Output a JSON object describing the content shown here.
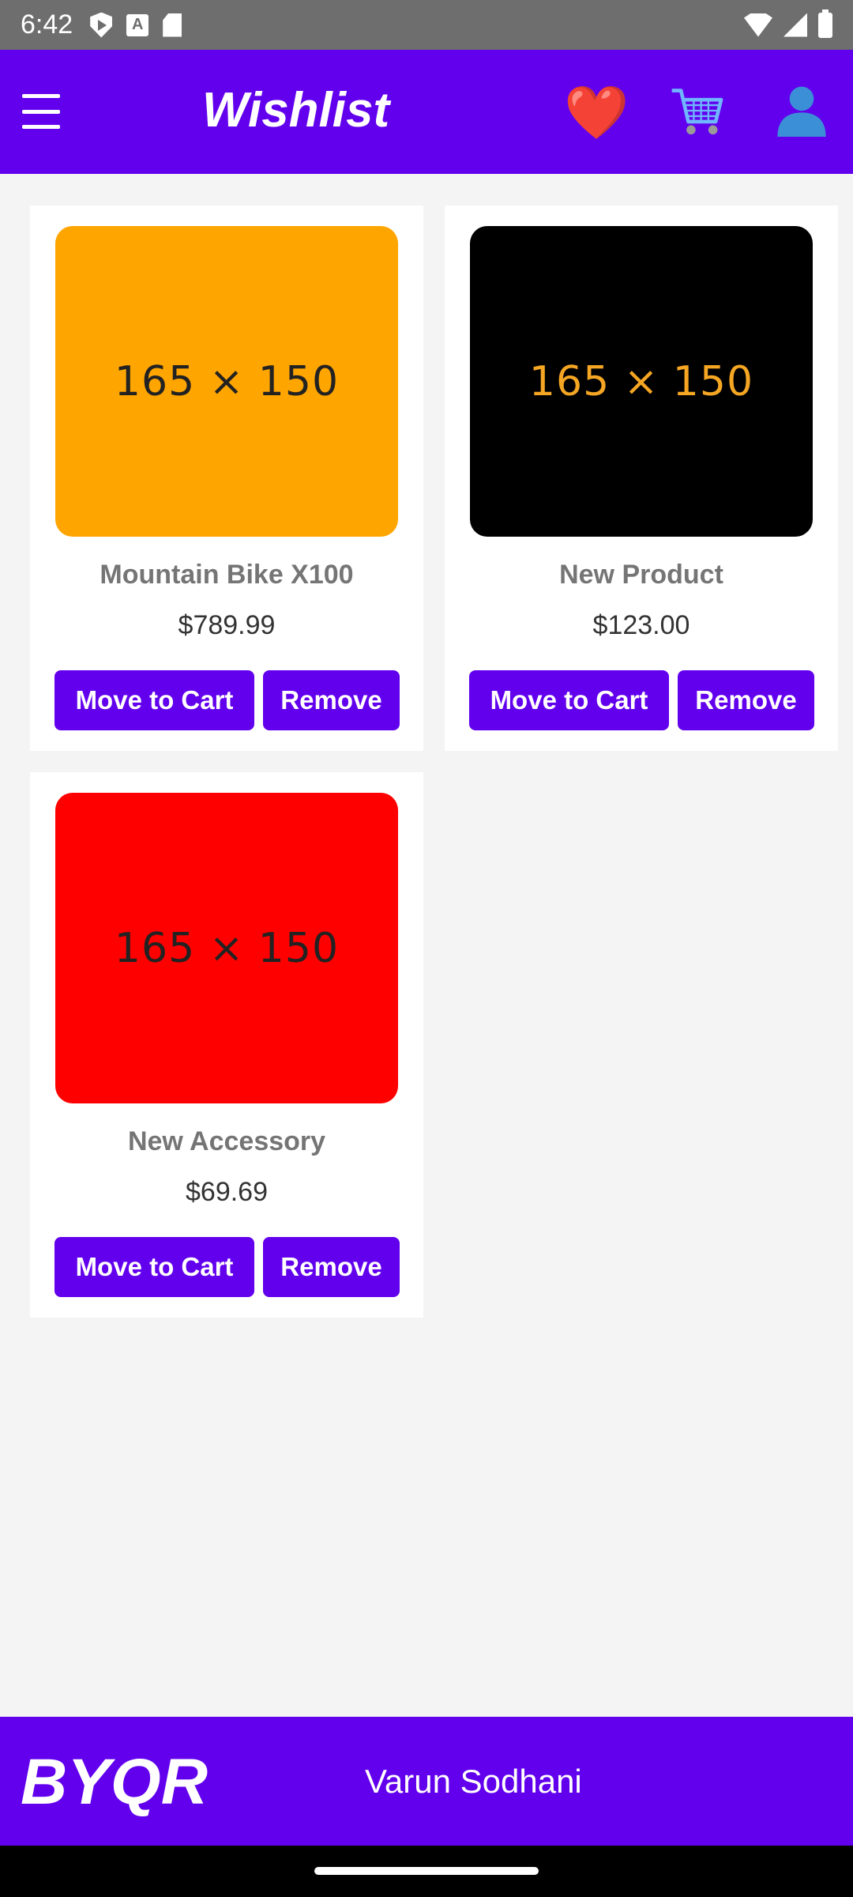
{
  "status_bar": {
    "time": "6:42",
    "icons": [
      "play-protect-icon",
      "font-a-icon",
      "sd-card-icon",
      "wifi-icon",
      "signal-icon",
      "battery-icon"
    ]
  },
  "header": {
    "title": "Wishlist",
    "menu_icon": "hamburger-menu-icon",
    "heart_glyph": "❤️",
    "cart_icon": "shopping-cart-icon",
    "user_icon": "user-profile-icon",
    "background": "#6200ee"
  },
  "products": [
    {
      "image_label": "165 × 150",
      "image_bg": "#ffa500",
      "image_fg": "#222222",
      "name": "Mountain Bike X100",
      "price": "$789.99",
      "move_label": "Move to Cart",
      "remove_label": "Remove"
    },
    {
      "image_label": "165 × 150",
      "image_bg": "#000000",
      "image_fg": "#f5a623",
      "name": "New Product",
      "price": "$123.00",
      "move_label": "Move to Cart",
      "remove_label": "Remove"
    },
    {
      "image_label": "165 × 150",
      "image_bg": "#ff0000",
      "image_fg": "#222222",
      "name": "New Accessory",
      "price": "$69.69",
      "move_label": "Move to Cart",
      "remove_label": "Remove"
    }
  ],
  "footer": {
    "brand": "BYQR",
    "author": "Varun Sodhani"
  },
  "colors": {
    "accent": "#6200ee",
    "page_background": "#f4f4f4",
    "status_bar": "#6e6e6e"
  }
}
